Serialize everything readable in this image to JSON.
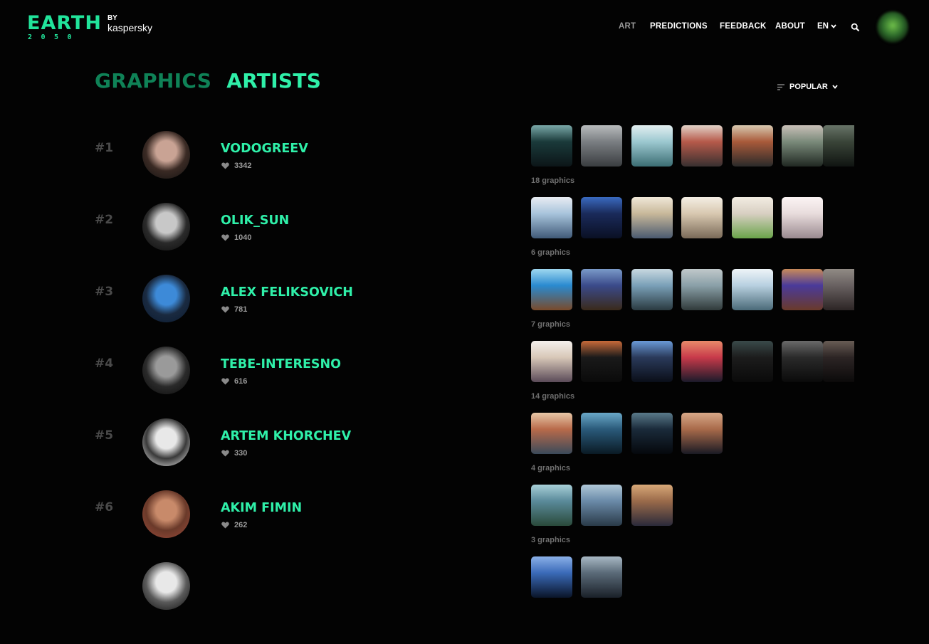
{
  "logo": {
    "word": "EARTH",
    "year": "2050",
    "by": "BY",
    "brand": "kaspersky"
  },
  "nav": {
    "items": [
      "ART",
      "PREDICTIONS",
      "FEEDBACK",
      "ABOUT"
    ],
    "active": "ART",
    "lang": "EN"
  },
  "tabs": {
    "graphics": "GRAPHICS",
    "artists": "ARTISTS",
    "active": "ARTISTS"
  },
  "sort": {
    "label": "POPULAR"
  },
  "colors": {
    "accent": "#2ff0a9",
    "accent_dim": "#0f8257",
    "rank": "#4a4a4a",
    "muted": "#9a9a9a"
  },
  "artists": [
    {
      "rank": "#1",
      "name": "VODOGREEV",
      "likes": "3342",
      "count": "18 graphics",
      "avatar": [
        "#c9a394",
        "#3a2a24",
        "#111"
      ],
      "thumbs": [
        [
          "#1a3a3a",
          "#0c1518",
          "#7aa8a8"
        ],
        [
          "#7a7e82",
          "#3a3d40",
          "#b9bcbd"
        ],
        [
          "#9cc8d0",
          "#3b6d73",
          "#e3eff1"
        ],
        [
          "#b65a4a",
          "#383030",
          "#e2d2c8"
        ],
        [
          "#a85a3a",
          "#2a2a2a",
          "#d8c9b0"
        ],
        [
          "#7a8a7a",
          "#202822",
          "#c9c0b8"
        ],
        [
          "#4c5a4a",
          "#141a16",
          "#8a9a8a"
        ]
      ]
    },
    {
      "rank": "#2",
      "name": "OLIK_SUN",
      "likes": "1040",
      "count": "6 graphics",
      "avatar": [
        "#c8c8c8",
        "#2a2a2a",
        "#0a0a0a"
      ],
      "thumbs": [
        [
          "#a8c4dc",
          "#405a78",
          "#e8ecf2"
        ],
        [
          "#1a2a5a",
          "#0a1024",
          "#3a6ac0"
        ],
        [
          "#c8b89a",
          "#4a5a70",
          "#f0e8d8"
        ],
        [
          "#d8c8b0",
          "#7a6a58",
          "#f4eee4"
        ],
        [
          "#d8cfc2",
          "#6aa44a",
          "#f2ece2"
        ],
        [
          "#e8dcdc",
          "#9a8a90",
          "#fbf4f4"
        ]
      ]
    },
    {
      "rank": "#3",
      "name": "ALEX FELIKSOVICH",
      "likes": "781",
      "count": "7 graphics",
      "avatar": [
        "#3d8ad8",
        "#1a2a40",
        "#0a1a30"
      ],
      "thumbs": [
        [
          "#2a8ad0",
          "#7a4a2a",
          "#9fd8f0"
        ],
        [
          "#3a4a8a",
          "#3a2a1a",
          "#7a9ac8"
        ],
        [
          "#7aa0b8",
          "#2a3a40",
          "#c8d8e0"
        ],
        [
          "#8aa0a8",
          "#303a3a",
          "#c0c8ca"
        ],
        [
          "#b8d0e0",
          "#4a6a78",
          "#eef4f8"
        ],
        [
          "#4a3a9a",
          "#6a3a2a",
          "#c88a5a"
        ],
        [
          "#8a8080",
          "#3a3030",
          "#c0b8b0"
        ]
      ]
    },
    {
      "rank": "#4",
      "name": "TEBE-INTERESNO",
      "likes": "616",
      "count": "14 graphics",
      "avatar": [
        "#9a9a9a",
        "#2a2a2a",
        "#0a0a0a"
      ],
      "thumbs": [
        [
          "#d8c8b8",
          "#5a4a58",
          "#f4f0ec"
        ],
        [
          "#1a1a1a",
          "#0a0a0a",
          "#c86a3a"
        ],
        [
          "#2a3a5a",
          "#0a0e18",
          "#6a9ad8"
        ],
        [
          "#c83a4a",
          "#1a1a2a",
          "#e88a6a"
        ],
        [
          "#1c1c1c",
          "#0a0a0a",
          "#3a4a4a"
        ],
        [
          "#2a2a2a",
          "#0a0a0a",
          "#6a6a6a"
        ],
        [
          "#3a3030",
          "#0e0c0c",
          "#8a7a70"
        ]
      ]
    },
    {
      "rank": "#5",
      "name": "ARTEM KHORCHEV",
      "likes": "330",
      "count": "4 graphics",
      "avatar": [
        "#e8e8e8",
        "#3a3a3a",
        "#f8f8f8"
      ],
      "thumbs": [
        [
          "#b86a4a",
          "#3a4a5a",
          "#e8c8a8"
        ],
        [
          "#2a5a7a",
          "#0a1a24",
          "#6aa8c8"
        ],
        [
          "#1a2a3a",
          "#05080c",
          "#5a7a8a"
        ],
        [
          "#a86a4a",
          "#1a1a24",
          "#d8a888"
        ]
      ]
    },
    {
      "rank": "#6",
      "name": "AKIM FIMIN",
      "likes": "262",
      "count": "3 graphics",
      "avatar": [
        "#c88a6a",
        "#6a3a2a",
        "#a04a3a"
      ],
      "thumbs": [
        [
          "#5a8a9a",
          "#2a4a3a",
          "#a8d0d8"
        ],
        [
          "#6a8aa8",
          "#2a3a48",
          "#b0c8d8"
        ],
        [
          "#9a6a4a",
          "#2a2a3a",
          "#d8a878"
        ]
      ]
    },
    {
      "rank": "",
      "name": "",
      "likes": "",
      "count": "",
      "avatar": [
        "#e8e8e8",
        "#5a5a5a",
        "#0a0a0a"
      ],
      "thumbs": [
        [
          "#3a6ab8",
          "#0a1428",
          "#8ab0e8"
        ],
        [
          "#5a6a78",
          "#1a2028",
          "#a8b8c4"
        ]
      ]
    }
  ]
}
